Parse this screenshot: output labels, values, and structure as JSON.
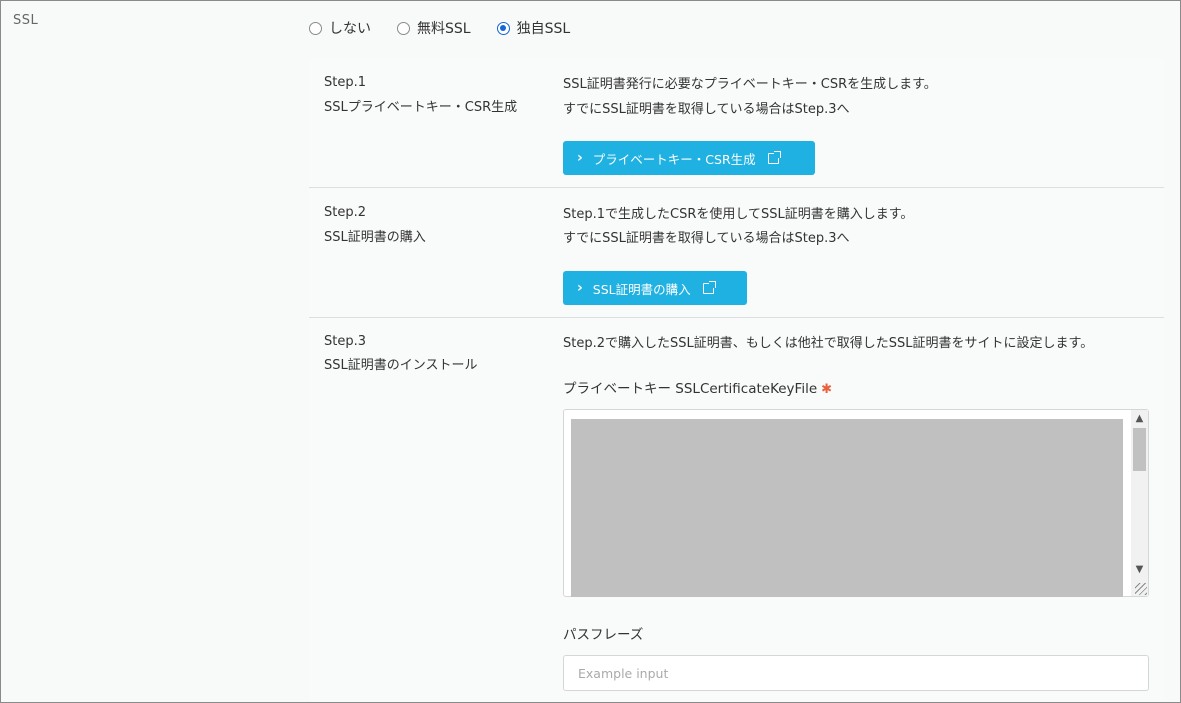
{
  "section_label": "SSL",
  "ssl_options": [
    {
      "label": "しない",
      "selected": false
    },
    {
      "label": "無料SSL",
      "selected": false
    },
    {
      "label": "独自SSL",
      "selected": true
    }
  ],
  "steps": [
    {
      "step": "Step.1",
      "name": "SSLプライベートキー・CSR生成",
      "desc_line1": "SSL証明書発行に必要なプライベートキー・CSRを生成します。",
      "desc_line2": "すでにSSL証明書を取得している場合はStep.3へ",
      "button_label": "プライベートキー・CSR生成"
    },
    {
      "step": "Step.2",
      "name": "SSL証明書の購入",
      "desc_line1": "Step.1で生成したCSRを使用してSSL証明書を購入します。",
      "desc_line2": "すでにSSL証明書を取得している場合はStep.3へ",
      "button_label": "SSL証明書の購入"
    },
    {
      "step": "Step.3",
      "name": "SSL証明書のインストール",
      "desc_line1": "Step.2で購入したSSL証明書、もしくは他社で取得したSSL証明書をサイトに設定します。",
      "private_key_label": "プライベートキー SSLCertificateKeyFile",
      "required_mark": "✱",
      "passphrase_label": "パスフレーズ",
      "passphrase_placeholder": "Example input",
      "passphrase_value": ""
    }
  ],
  "colors": {
    "button": "#1fb1e1",
    "radio_selected": "#1565d8",
    "required": "#e8603c"
  }
}
